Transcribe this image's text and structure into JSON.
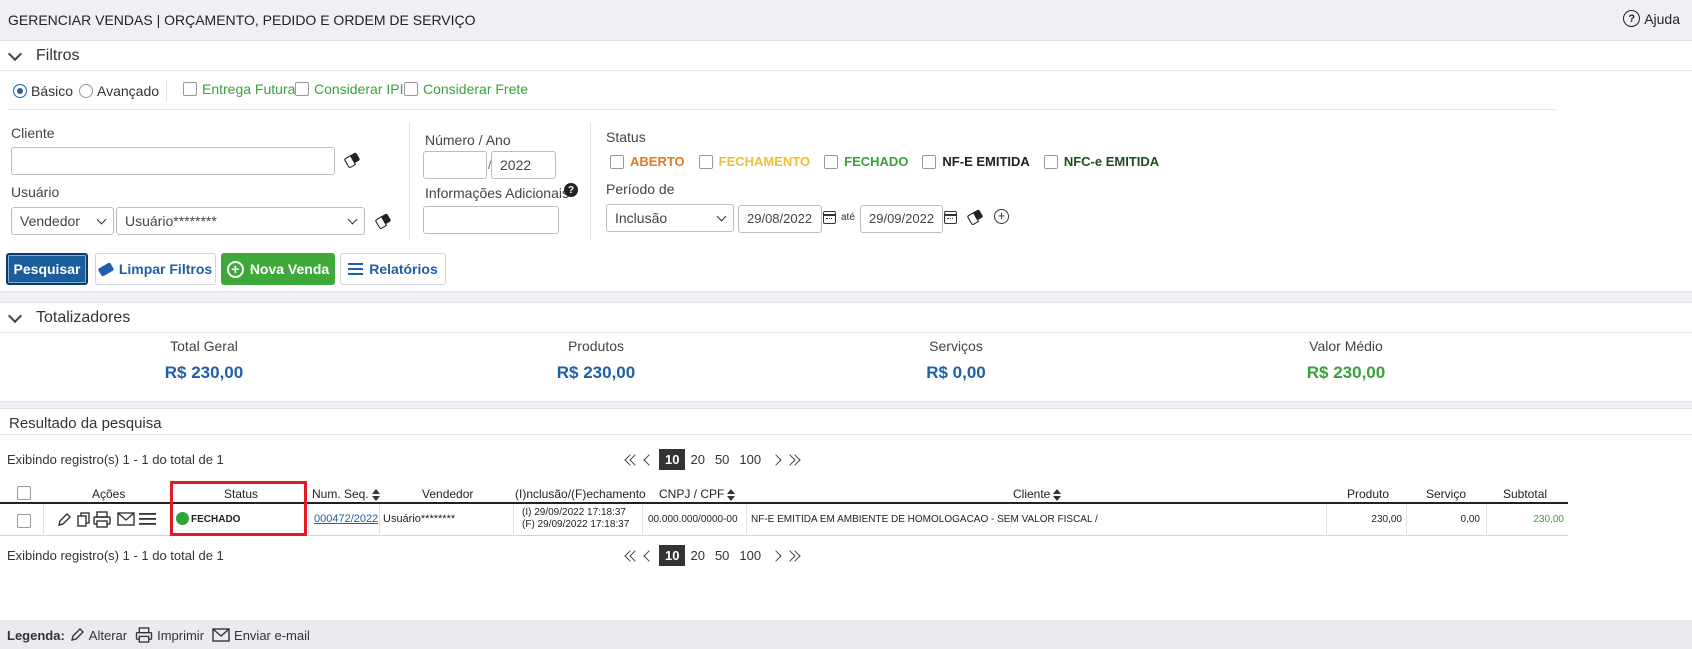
{
  "header": {
    "title": "GERENCIAR VENDAS | ORÇAMENTO, PEDIDO E ORDEM DE SERVIÇO",
    "help_label": "Ajuda"
  },
  "filters": {
    "section_label": "Filtros",
    "mode_basic": "Básico",
    "mode_advanced": "Avançado",
    "opt_future_delivery": "Entrega Futura",
    "opt_ipi": "Considerar IPI",
    "opt_freight": "Considerar Frete",
    "cliente_label": "Cliente",
    "cliente_value": "",
    "usuario_label": "Usuário",
    "usuario_role": "Vendedor",
    "usuario_value": "Usuário********",
    "numero_label": "Número / Ano",
    "numero_value": "",
    "ano_value": "2022",
    "info_label": "Informações Adicionais",
    "info_value": "",
    "status_label": "Status",
    "status_options": [
      {
        "label": "ABERTO",
        "color": "#e07b24"
      },
      {
        "label": "FECHAMENTO",
        "color": "#f0c030"
      },
      {
        "label": "FECHADO",
        "color": "#3aa23a"
      },
      {
        "label": "NF-E EMITIDA",
        "color": "#222222"
      },
      {
        "label": "NFC-e EMITIDA",
        "color": "#1e4d1e"
      }
    ],
    "periodo_label": "Período de",
    "periodo_type": "Inclusão",
    "date_from": "29/08/2022",
    "date_sep": "até",
    "date_to": "29/09/2022"
  },
  "actions": {
    "search": "Pesquisar",
    "clear": "Limpar Filtros",
    "new_sale": "Nova Venda",
    "reports": "Relatórios"
  },
  "totals": {
    "section_label": "Totalizadores",
    "items": [
      {
        "label": "Total Geral",
        "value": "R$ 230,00",
        "color": "#1f5fa9"
      },
      {
        "label": "Produtos",
        "value": "R$ 230,00",
        "color": "#1f5fa9"
      },
      {
        "label": "Serviços",
        "value": "R$ 0,00",
        "color": "#1f5fa9"
      },
      {
        "label": "Valor Médio",
        "value": "R$ 230,00",
        "color": "#3aa23a"
      }
    ]
  },
  "results": {
    "section_label": "Resultado da pesquisa",
    "records_text": "Exibindo registro(s) 1 - 1 do total de 1",
    "page_sizes": [
      "10",
      "20",
      "50",
      "100"
    ],
    "columns": {
      "acoes": "Ações",
      "status": "Status",
      "num_seq": "Num. Seq.",
      "vendedor": "Vendedor",
      "inclusao": "(I)nclusão/(F)echamento",
      "cnpj": "CNPJ / CPF",
      "cliente": "Cliente",
      "produto": "Produto",
      "servico": "Serviço",
      "subtotal": "Subtotal"
    },
    "rows": [
      {
        "status": "FECHADO",
        "num_seq": "000472/2022",
        "vendedor": "Usuário********",
        "inclusao": "(I) 29/09/2022 17:18:37",
        "fechamento": "(F) 29/09/2022 17:18:37",
        "cnpj": "00.000.000/0000-00",
        "cliente": "NF-E EMITIDA EM AMBIENTE DE HOMOLOGACAO - SEM VALOR FISCAL /",
        "produto": "230,00",
        "servico": "0,00",
        "subtotal": "230,00"
      }
    ]
  },
  "legend": {
    "title": "Legenda:",
    "edit": "Alterar",
    "print": "Imprimir",
    "email": "Enviar e-mail"
  }
}
